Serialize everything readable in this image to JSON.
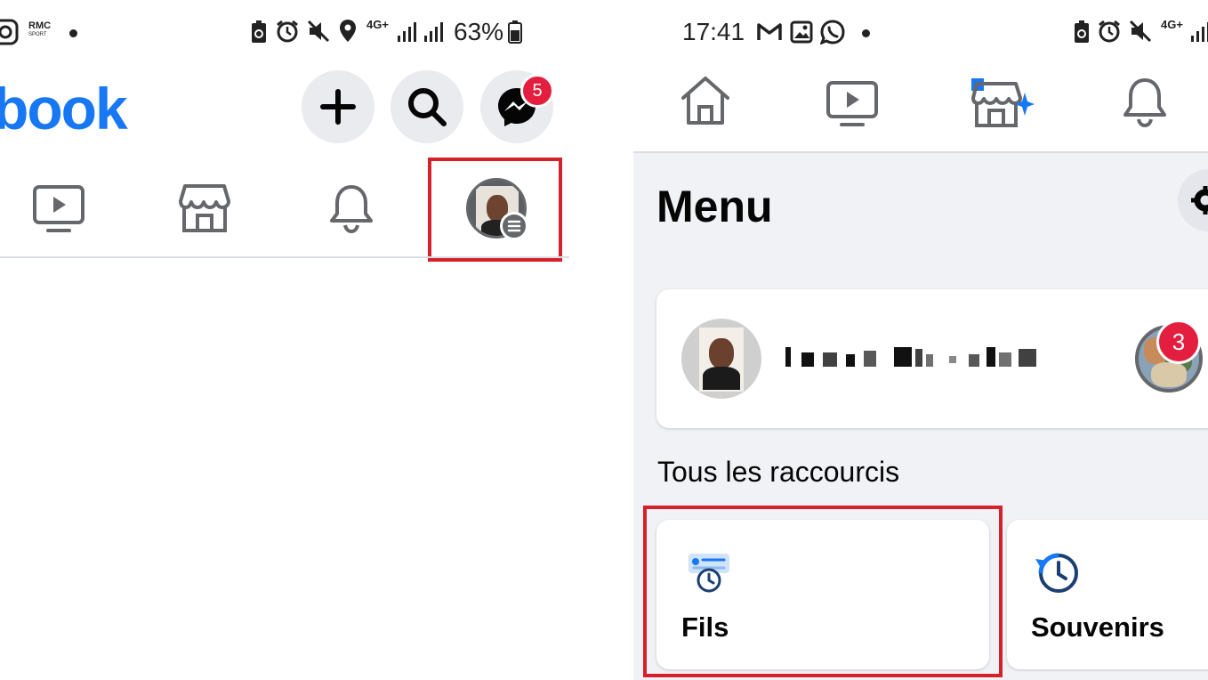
{
  "left_screen": {
    "status_bar": {
      "carrier_logo": "RMC",
      "carrier_sub": "SPORT",
      "network": "4G+",
      "battery": "63%"
    },
    "header": {
      "logo_text": "book",
      "messenger_badge": "5"
    },
    "nav_tabs": [
      "watch-icon",
      "marketplace-icon",
      "notifications-icon",
      "profile-menu-icon"
    ]
  },
  "right_screen": {
    "status_bar": {
      "time": "17:41",
      "network": "4G+"
    },
    "menu": {
      "title": "Menu",
      "story_badge": "3",
      "section_title": "Tous les raccourcis",
      "shortcuts": [
        {
          "label": "Fils",
          "icon": "feeds-icon"
        },
        {
          "label": "Souvenirs",
          "icon": "memories-icon"
        }
      ]
    }
  },
  "colors": {
    "brand": "#1877f2",
    "badge": "#e41e3f",
    "highlight": "#d6202a",
    "menu_bg": "#f0f2f5"
  }
}
